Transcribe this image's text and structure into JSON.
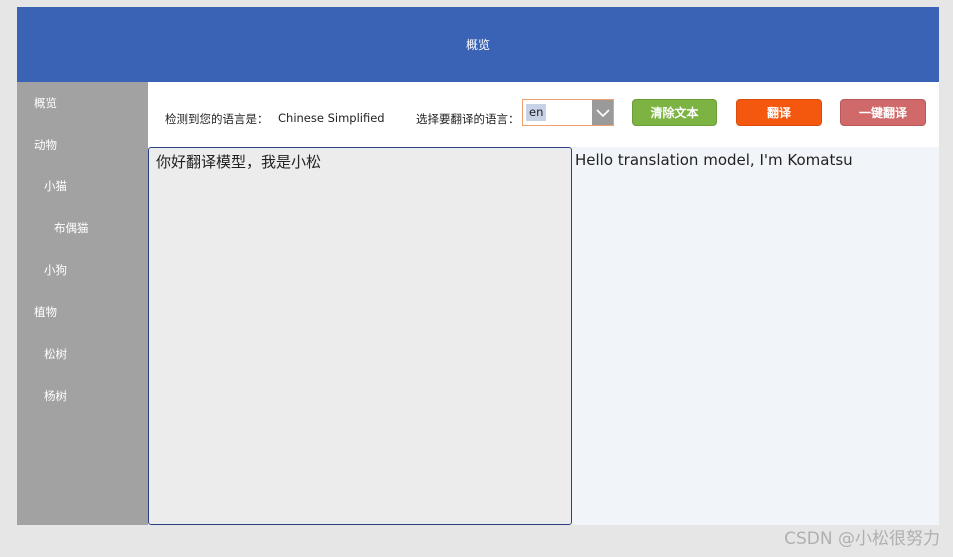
{
  "header": {
    "title": "概览"
  },
  "sidebar": {
    "items": [
      {
        "label": "概览"
      },
      {
        "label": "动物"
      },
      {
        "label": "小猫"
      },
      {
        "label": "布偶猫"
      },
      {
        "label": "小狗"
      },
      {
        "label": "植物"
      },
      {
        "label": "松树"
      },
      {
        "label": "杨树"
      }
    ]
  },
  "toolbar": {
    "detected_label": "检测到您的语言是：",
    "detected_value": "Chinese Simplified",
    "target_label": "选择要翻译的语言：",
    "target_value": "en",
    "clear_button": "清除文本",
    "translate_button": "翻译",
    "onekey_button": "一键翻译"
  },
  "input": {
    "text": "你好翻译模型，我是小松"
  },
  "output": {
    "text": "Hello translation model, I'm Komatsu"
  },
  "watermark": "CSDN @小松很努力",
  "colors": {
    "header": "#3a62b5",
    "sidebar": "#a2a2a2",
    "clear_button": "#7cb342",
    "translate_button": "#f4580f",
    "onekey_button": "#d06a6a"
  }
}
